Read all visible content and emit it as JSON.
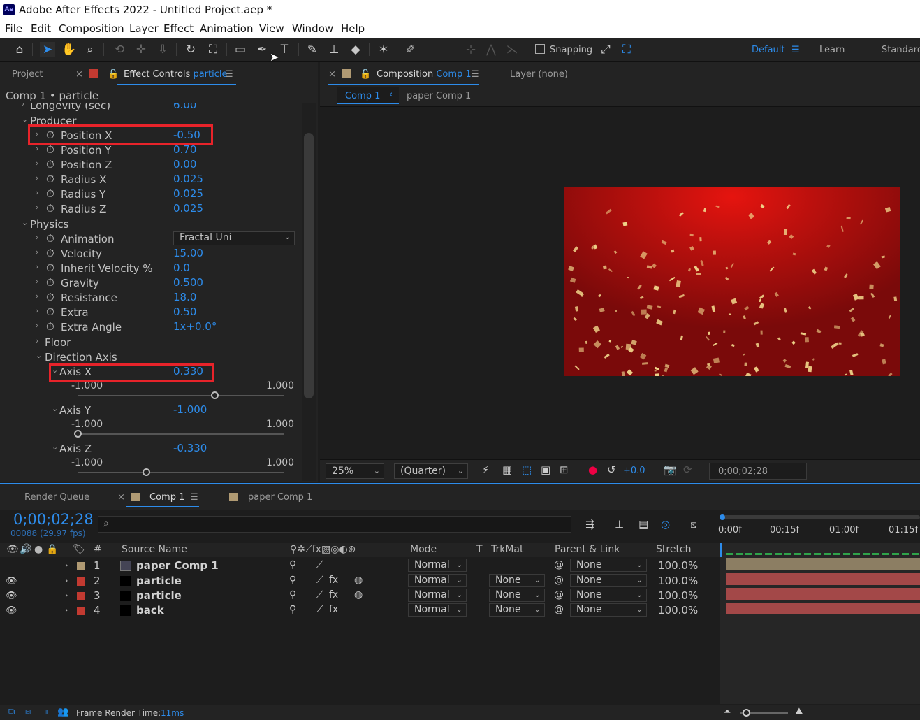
{
  "app": {
    "title": "Adobe After Effects 2022 - Untitled Project.aep *",
    "logo_text": "Ae"
  },
  "menu": [
    "File",
    "Edit",
    "Composition",
    "Layer",
    "Effect",
    "Animation",
    "View",
    "Window",
    "Help"
  ],
  "toolbar": {
    "snapping_label": "Snapping",
    "workspaces": [
      "Default",
      "Learn",
      "Standard"
    ],
    "tool_icons": [
      "home-icon",
      "selection-arrow-icon",
      "hand-icon",
      "zoom-icon",
      "orbit-icon",
      "pan-icon",
      "dolly-icon",
      "rotate-icon",
      "anchor-icon",
      "rectangle-icon",
      "pen-icon",
      "type-icon",
      "brush-icon",
      "clone-stamp-icon",
      "eraser-icon",
      "roto-brush-icon",
      "puppet-pin-icon"
    ]
  },
  "effect_controls": {
    "tab_project": "Project",
    "tab_effect_prefix": "Effect Controls",
    "tab_effect_target": "particle",
    "breadcrumb": "Comp 1 • particle",
    "rows": [
      {
        "label": "Longevity (sec)",
        "value": "6.00"
      },
      {
        "label": "Producer",
        "value": ""
      },
      {
        "label": "Position X",
        "value": "-0.50"
      },
      {
        "label": "Position Y",
        "value": "0.70"
      },
      {
        "label": "Position Z",
        "value": "0.00"
      },
      {
        "label": "Radius X",
        "value": "0.025"
      },
      {
        "label": "Radius Y",
        "value": "0.025"
      },
      {
        "label": "Radius Z",
        "value": "0.025"
      },
      {
        "label": "Physics",
        "value": ""
      },
      {
        "label": "Animation",
        "value": "Fractal Uni"
      },
      {
        "label": "Velocity",
        "value": "15.00"
      },
      {
        "label": "Inherit Velocity %",
        "value": "0.0"
      },
      {
        "label": "Gravity",
        "value": "0.500"
      },
      {
        "label": "Resistance",
        "value": "18.0"
      },
      {
        "label": "Extra",
        "value": "0.50"
      },
      {
        "label": "Extra Angle",
        "value": "1x+0.0°"
      },
      {
        "label": "Floor",
        "value": ""
      },
      {
        "label": "Direction Axis",
        "value": ""
      }
    ],
    "axes": [
      {
        "label": "Axis X",
        "value": "0.330",
        "min": "-1.000",
        "max": "1.000",
        "level": 0.665
      },
      {
        "label": "Axis Y",
        "value": "-1.000",
        "min": "-1.000",
        "max": "1.000",
        "level": 0.0
      },
      {
        "label": "Axis Z",
        "value": "-0.330",
        "min": "-1.000",
        "max": "1.000",
        "level": 0.335
      }
    ]
  },
  "composition": {
    "tab_prefix": "Composition",
    "tab_comp": "Comp 1",
    "layer_tab": "Layer (none)",
    "flow": [
      "Comp 1",
      "paper Comp 1"
    ],
    "zoom": "25%",
    "resolution": "(Quarter)",
    "exposure": "+0.0",
    "timecode": "0;00;02;28"
  },
  "timeline": {
    "tabs": [
      "Render Queue",
      "Comp 1",
      "paper Comp 1"
    ],
    "timecode": "0;00;02;28",
    "frame_info": "00088 (29.97 fps)",
    "search_placeholder": "",
    "headers": {
      "source": "Source Name",
      "mode": "Mode",
      "t": "T",
      "trkmat": "TrkMat",
      "parent": "Parent & Link",
      "stretch": "Stretch",
      "num": "#"
    },
    "ruler": [
      "0:00f",
      "00:15f",
      "01:00f",
      "01:15f"
    ],
    "layers": [
      {
        "num": "1",
        "name": "paper Comp 1",
        "mode": "Normal",
        "trkmat": "",
        "parent": "None",
        "stretch": "100.0%",
        "color": "#b09a73"
      },
      {
        "num": "2",
        "name": "particle",
        "mode": "Normal",
        "trkmat": "None",
        "parent": "None",
        "stretch": "100.0%",
        "color": "#c23a31"
      },
      {
        "num": "3",
        "name": "particle",
        "mode": "Normal",
        "trkmat": "None",
        "parent": "None",
        "stretch": "100.0%",
        "color": "#c23a31"
      },
      {
        "num": "4",
        "name": "back",
        "mode": "Normal",
        "trkmat": "None",
        "parent": "None",
        "stretch": "100.0%",
        "color": "#c23a31"
      }
    ]
  },
  "status": {
    "label": "Frame Render Time:",
    "value": "11ms"
  }
}
